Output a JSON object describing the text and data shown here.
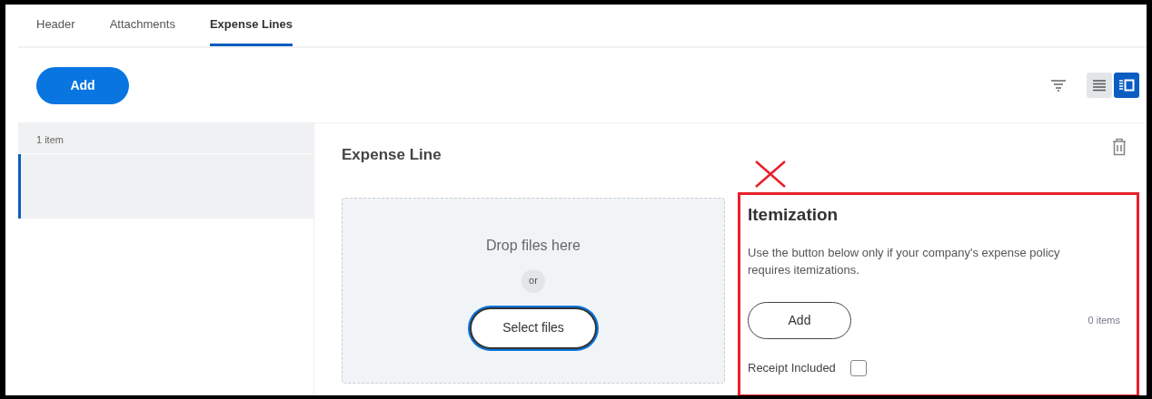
{
  "tabs": [
    {
      "label": "Header",
      "selected": false
    },
    {
      "label": "Attachments",
      "selected": false
    },
    {
      "label": "Expense Lines",
      "selected": true
    }
  ],
  "add_button": "Add",
  "view_modes": [
    {
      "kind": "list",
      "selected": false
    },
    {
      "kind": "detail",
      "selected": true
    }
  ],
  "list": {
    "count": "1 item",
    "rows": [
      {
        "selected": true
      }
    ]
  },
  "expense_line": {
    "title": "Expense Line",
    "dropzone": {
      "prompt": "Drop files here",
      "or": "or",
      "button": "Select files"
    }
  },
  "itemization": {
    "title": "Itemization",
    "description": "Use the button below only if your company's expense policy requires itemizations.",
    "add_button": "Add",
    "count": "0 items",
    "receipt_label": "Receipt Included",
    "receipt_checked": false,
    "highlighted": true
  }
}
